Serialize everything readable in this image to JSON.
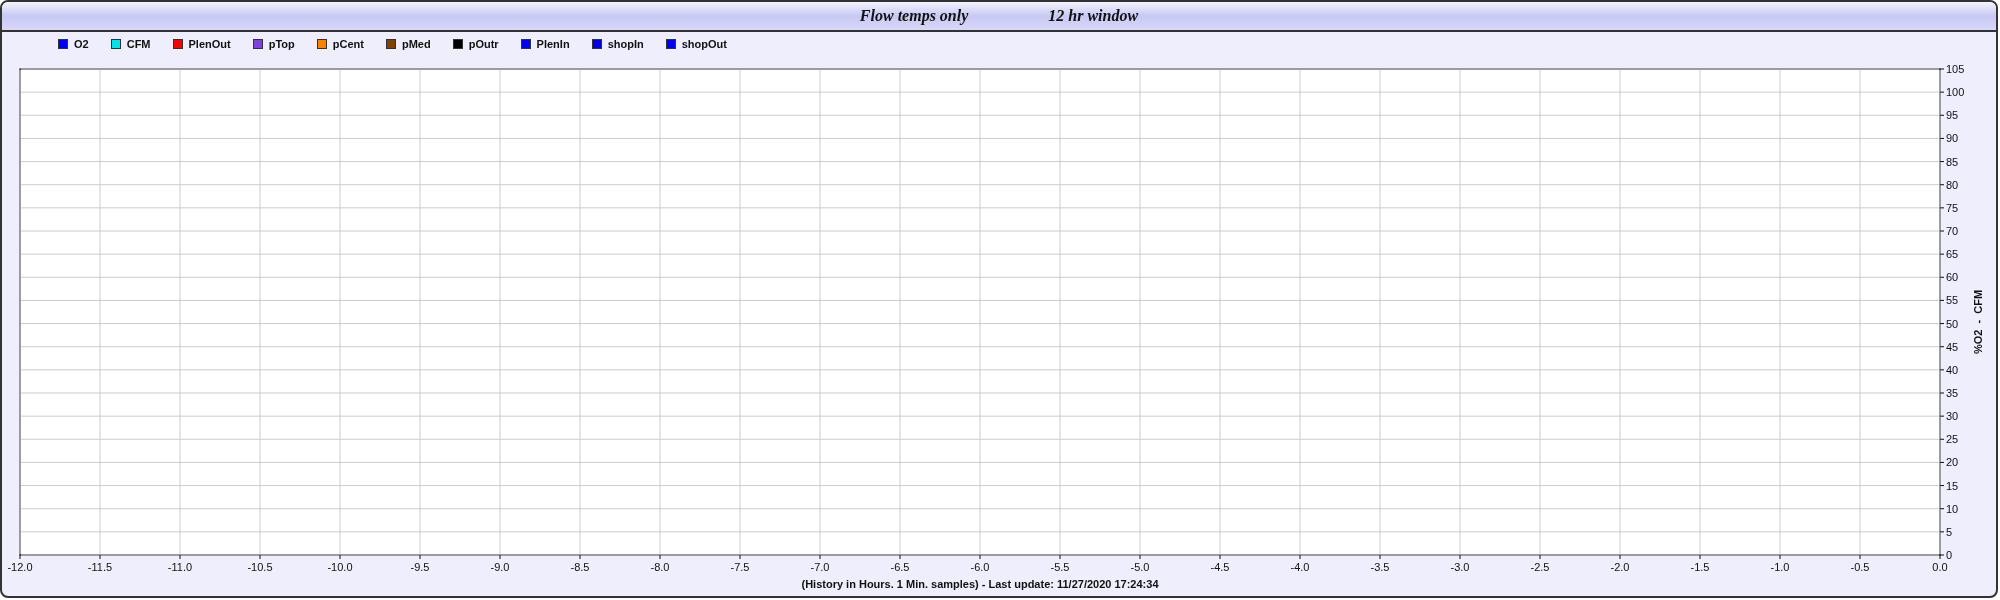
{
  "title_bar": [
    "Flow temps only",
    "12 hr window"
  ],
  "chart": {
    "chart_data": {
      "type": "line",
      "xlabel": "(History in Hours. 1 Min. samples) - Last update: 11/27/2020 17:24:34",
      "ylabel": "%O2  -  CFM",
      "ylim": [
        0,
        105
      ],
      "grid": true,
      "series": [
        {
          "name": "O2",
          "color": "#0000ff",
          "values": [
            null,
            null,
            null,
            null,
            null,
            null,
            null,
            null,
            null,
            null,
            null,
            null,
            null,
            null,
            null,
            null,
            null,
            null,
            null,
            null,
            null,
            null,
            null,
            null,
            null
          ]
        },
        {
          "name": "CFM",
          "color": "#00e5e5",
          "values": [
            null,
            null,
            null,
            null,
            null,
            null,
            null,
            null,
            null,
            null,
            null,
            null,
            null,
            null,
            null,
            null,
            null,
            null,
            null,
            null,
            null,
            null,
            null,
            null,
            null
          ]
        },
        {
          "name": "PlenOut",
          "color": "#ff0000",
          "values": [
            null,
            null,
            null,
            null,
            null,
            null,
            null,
            null,
            null,
            null,
            null,
            null,
            null,
            null,
            null,
            null,
            null,
            null,
            null,
            null,
            null,
            null,
            null,
            null,
            null
          ]
        },
        {
          "name": "pTop",
          "color": "#8040e0",
          "values": [
            null,
            null,
            null,
            null,
            null,
            null,
            null,
            null,
            null,
            null,
            null,
            null,
            null,
            null,
            null,
            null,
            null,
            null,
            null,
            null,
            null,
            null,
            null,
            null,
            null
          ]
        },
        {
          "name": "pCent",
          "color": "#ff8000",
          "values": [
            null,
            null,
            null,
            null,
            null,
            null,
            null,
            null,
            null,
            null,
            null,
            null,
            null,
            null,
            null,
            null,
            null,
            null,
            null,
            null,
            null,
            null,
            null,
            null,
            null
          ]
        },
        {
          "name": "pMed",
          "color": "#804000",
          "values": [
            null,
            null,
            null,
            null,
            null,
            null,
            null,
            null,
            null,
            null,
            null,
            null,
            null,
            null,
            null,
            null,
            null,
            null,
            null,
            null,
            null,
            null,
            null,
            null,
            null
          ]
        },
        {
          "name": "pOutr",
          "color": "#000000",
          "values": [
            null,
            null,
            null,
            null,
            null,
            null,
            null,
            null,
            null,
            null,
            null,
            null,
            null,
            null,
            null,
            null,
            null,
            null,
            null,
            null,
            null,
            null,
            null,
            null,
            null
          ]
        },
        {
          "name": "PlenIn",
          "color": "#0000ff",
          "values": [
            null,
            null,
            null,
            null,
            null,
            null,
            null,
            null,
            null,
            null,
            null,
            null,
            null,
            null,
            null,
            null,
            null,
            null,
            null,
            null,
            null,
            null,
            null,
            null,
            null
          ]
        },
        {
          "name": "shopIn",
          "color": "#0000e0",
          "values": [
            null,
            null,
            null,
            null,
            null,
            null,
            null,
            null,
            null,
            null,
            null,
            null,
            null,
            null,
            null,
            null,
            null,
            null,
            null,
            null,
            null,
            null,
            null,
            null,
            null
          ]
        },
        {
          "name": "shopOut",
          "color": "#0000ff",
          "values": [
            null,
            null,
            null,
            null,
            null,
            null,
            null,
            null,
            null,
            null,
            null,
            null,
            null,
            null,
            null,
            null,
            null,
            null,
            null,
            null,
            null,
            null,
            null,
            null,
            null
          ]
        }
      ],
      "categories": [
        "-12.0",
        "-11.5",
        "-11.0",
        "-10.5",
        "-10.0",
        "-9.5",
        "-9.0",
        "-8.5",
        "-8.0",
        "-7.5",
        "-7.0",
        "-6.5",
        "-6.0",
        "-5.5",
        "-5.0",
        "-4.5",
        "-4.0",
        "-3.5",
        "-3.0",
        "-2.5",
        "-2.0",
        "-1.5",
        "-1.0",
        "-0.5",
        "0.0"
      ],
      "yticks": [
        0,
        5,
        10,
        15,
        20,
        25,
        30,
        35,
        40,
        45,
        50,
        55,
        60,
        65,
        70,
        75,
        80,
        85,
        90,
        95,
        100,
        105
      ]
    }
  }
}
